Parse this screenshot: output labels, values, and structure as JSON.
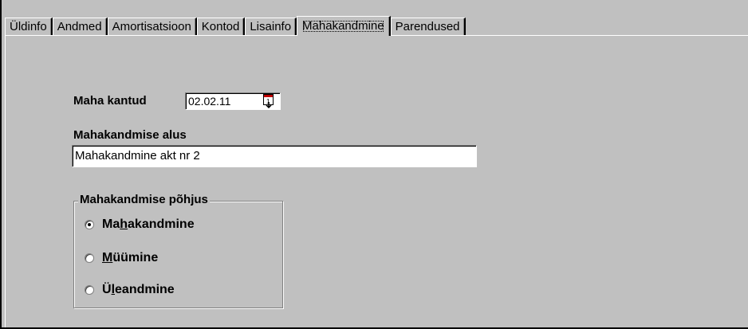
{
  "tabs": [
    {
      "label": "Üldinfo",
      "active": false
    },
    {
      "label": "Andmed",
      "active": false
    },
    {
      "label": "Amortisatsioon",
      "active": false
    },
    {
      "label": "Kontod",
      "active": false
    },
    {
      "label": "Lisainfo",
      "active": false
    },
    {
      "label": "Mahakandmine",
      "active": true
    },
    {
      "label": "Parendused",
      "active": false
    }
  ],
  "form": {
    "date_label": "Maha kantud",
    "date_value": "02.02.11",
    "basis_label": "Mahakandmise alus",
    "basis_value": "Mahakandmine akt nr 2",
    "reason_group_title": "Mahakandmise põhjus",
    "reasons": [
      {
        "pre": "Ma",
        "accel": "h",
        "post": "akandmine",
        "checked": true
      },
      {
        "pre": "",
        "accel": "M",
        "post": "üümine",
        "checked": false
      },
      {
        "pre": "Ü",
        "accel": "l",
        "post": "eandmine",
        "checked": false
      }
    ]
  }
}
